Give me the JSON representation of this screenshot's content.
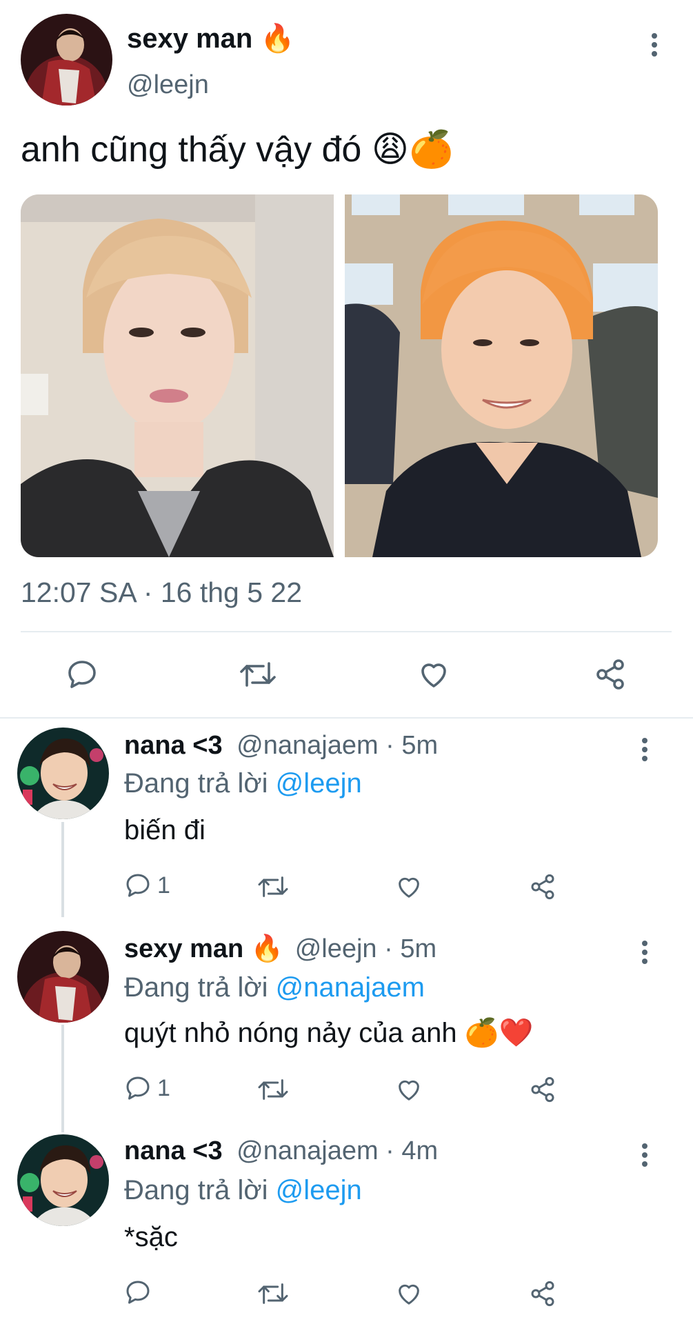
{
  "main_tweet": {
    "display_name": "sexy man",
    "name_emoji": "🔥",
    "handle": "@leejn",
    "text": "anh cũng thấy vậy đó 😩🍊",
    "timestamp": "12:07 SA · 16 thg 5 22",
    "actions": [
      "reply-icon",
      "retweet-icon",
      "like-icon",
      "share-icon"
    ]
  },
  "replies": [
    {
      "display_name": "nana <3",
      "name_emoji": "",
      "meta": "@nanajaem · 5m",
      "replying_prefix": "Đang trả lời",
      "replying_to": "@leejn",
      "text": "biến đi",
      "reply_count": "1"
    },
    {
      "display_name": "sexy man",
      "name_emoji": "🔥",
      "meta": "@leejn · 5m",
      "replying_prefix": "Đang trả lời",
      "replying_to": "@nanajaem",
      "text": "quýt nhỏ nóng nảy của anh 🍊❤️",
      "reply_count": "1"
    },
    {
      "display_name": "nana <3",
      "name_emoji": "",
      "meta": "@nanajaem · 4m",
      "replying_prefix": "Đang trả lời",
      "replying_to": "@leejn",
      "text": "*sặc",
      "reply_count": ""
    }
  ],
  "colors": {
    "accent": "#1d9bf0",
    "muted": "#536471",
    "divider": "#e6ecf0"
  }
}
